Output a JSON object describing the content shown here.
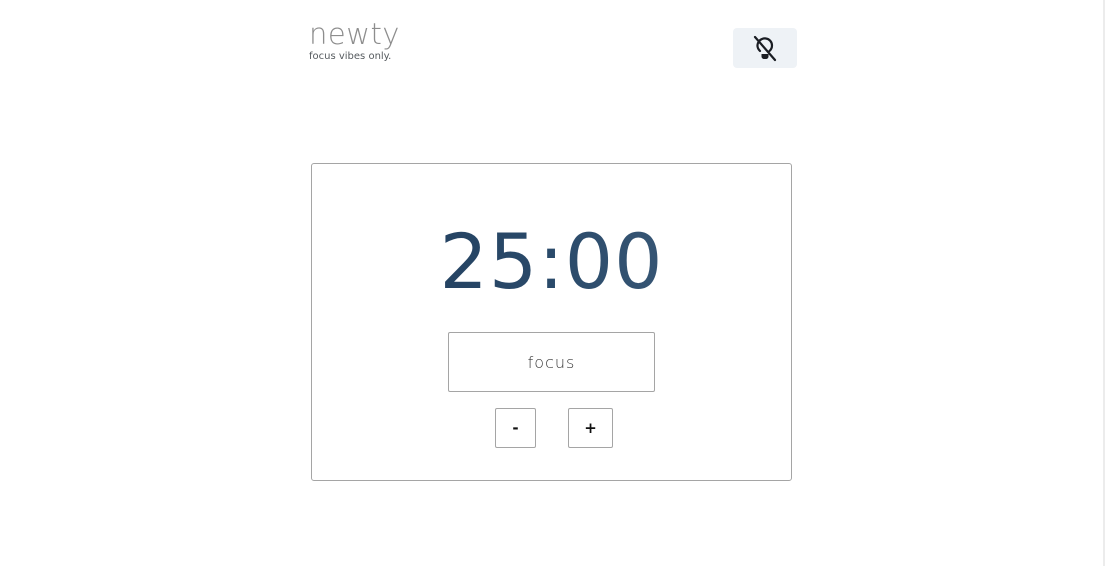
{
  "brand": {
    "name": "newty",
    "tagline": "focus vibes only."
  },
  "header": {
    "theme_toggle_icon": "lightbulb-off-icon"
  },
  "timer": {
    "display": "25:00",
    "gradient_colors": [
      "#1f3b5a",
      "#44627f"
    ]
  },
  "controls": {
    "mode_label": "focus",
    "decrement_label": "-",
    "increment_label": "+"
  }
}
